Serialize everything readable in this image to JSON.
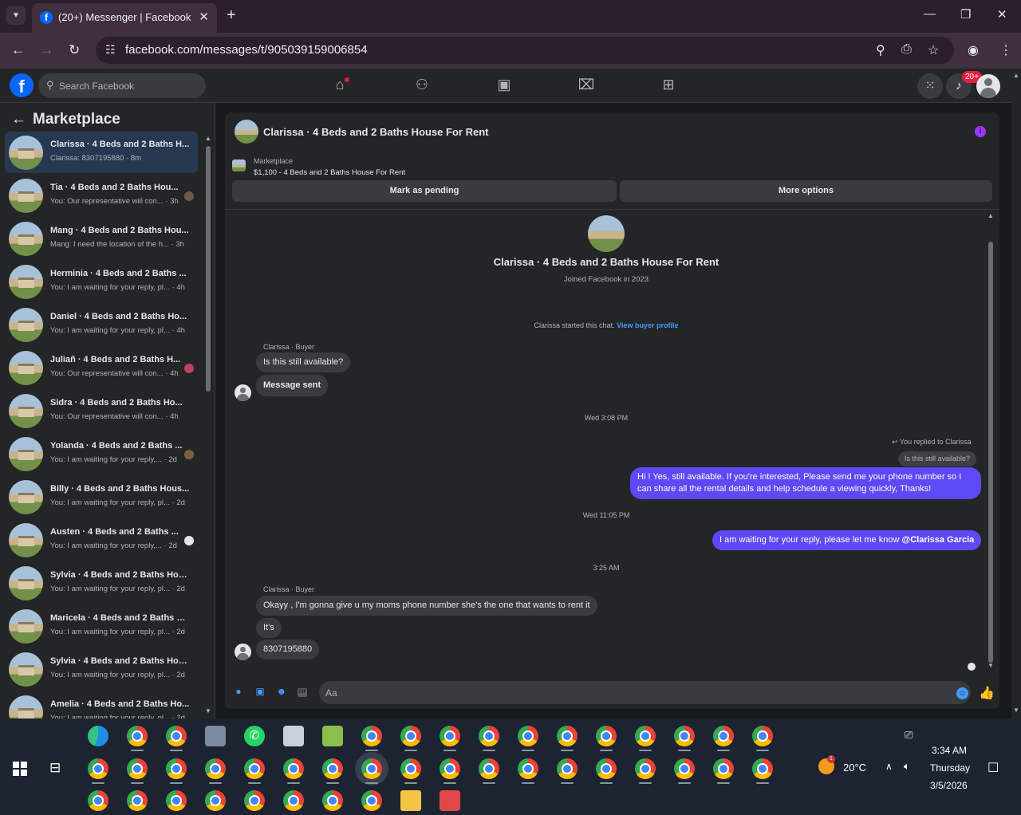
{
  "browser": {
    "tab_title": "(20+) Messenger | Facebook",
    "url": "facebook.com/messages/t/905039159006854",
    "favicon_letter": "f"
  },
  "fb": {
    "search_placeholder": "Search Facebook",
    "logo_letter": "f",
    "notif_badge": "20+"
  },
  "sidebar": {
    "title": "Marketplace",
    "conversations": [
      {
        "name": "Clarissa · 4 Beds and 2 Baths H...",
        "preview": "Clarissa: 8307195880 · 8m"
      },
      {
        "name": "Tia · 4 Beds and 2 Baths Hou...",
        "preview": "You: Our representative will con... · 3h"
      },
      {
        "name": "Mang · 4 Beds and 2 Baths Hou...",
        "preview": "Mang: I need the location of the h... · 3h"
      },
      {
        "name": "Herminia · 4 Beds and 2 Baths ...",
        "preview": "You: I am waiting for your reply, pl... · 4h"
      },
      {
        "name": "Daniel · 4 Beds and 2 Baths Ho...",
        "preview": "You: I am waiting for your reply, pl... · 4h"
      },
      {
        "name": "Juliañ · 4 Beds and 2 Baths H...",
        "preview": "You: Our representative will con... · 4h"
      },
      {
        "name": "Sidra · 4 Beds and 2 Baths Ho...",
        "preview": "You: Our representative will con... · 4h"
      },
      {
        "name": "Yolanda · 4 Beds and 2 Baths ...",
        "preview": "You: I am waiting for your reply,... · 2d"
      },
      {
        "name": "Billy · 4 Beds and 2 Baths Hous...",
        "preview": "You: I am waiting for your reply, pl... · 2d"
      },
      {
        "name": "Austen · 4 Beds and 2 Baths ...",
        "preview": "You: I am waiting for your reply,... · 2d"
      },
      {
        "name": "Sylvia · 4 Beds and 2 Baths Hou...",
        "preview": "You: I am waiting for your reply, pl... · 2d"
      },
      {
        "name": "Maricela · 4 Beds and 2 Baths H...",
        "preview": "You: I am waiting for your reply, pl... · 2d"
      },
      {
        "name": "Sylvia · 4 Beds and 2 Baths Hou...",
        "preview": "You: I am waiting for your reply, pl... · 2d"
      },
      {
        "name": "Amelia · 4 Beds and 2 Baths Ho...",
        "preview": "You: I am waiting for your reply, pl... · 2d"
      }
    ]
  },
  "chat": {
    "header_title": "Clarissa · 4 Beds and 2 Baths House For Rent",
    "marketplace_label": "Marketplace",
    "listing": "$1,100 - 4 Beds and 2 Baths House For Rent",
    "mark_pending": "Mark as pending",
    "more_options": "More options",
    "profile_name": "Clarissa · 4 Beds and 2 Baths House For Rent",
    "profile_sub": "Joined Facebook in 2023",
    "started_text": "Clarissa started this chat.",
    "view_profile": "View buyer profile",
    "sender_1": "Clarissa · Buyer",
    "msg_1": "Is this still available?",
    "msg_2": "Message sent",
    "time_1": "Wed 3:08 PM",
    "reply_note": "You replied to Clarissa",
    "reply_quote": "Is this still available?",
    "msg_3": "Hi ! Yes, still available. If you're interested, Please send me your phone number so I can share all the rental details and help schedule a viewing quickly, Thanks!",
    "time_2": "Wed 11:05 PM",
    "msg_4_text": "I am waiting for your reply, please let me know",
    "msg_4_mention": "@Clarissa Garcia",
    "time_3": "3:25 AM",
    "sender_2": "Clarissa · Buyer",
    "msg_5": "Okayy , I'm gonna give u my moms phone number she's the one that wants to rent it",
    "msg_6": "It's",
    "msg_7": "8307195880",
    "composer_placeholder": "Aa"
  },
  "taskbar": {
    "temperature": "20°C",
    "weather_badge": "1",
    "time": "3:34 AM",
    "day": "Thursday",
    "date": "3/5/2026"
  },
  "colors": {
    "accent": "#0866ff",
    "my_bubble": "#5d49f5",
    "link": "#4599ff",
    "active_conv": "#263951"
  },
  "icons": [
    "search-icon",
    "home-icon",
    "friends-icon",
    "video-icon",
    "marketplace-icon",
    "gaming-icon",
    "menu-grid-icon",
    "bell-icon",
    "info-icon",
    "mic-icon",
    "image-icon",
    "sticker-icon",
    "gif-icon",
    "emoji-icon",
    "thumbs-up-icon"
  ]
}
